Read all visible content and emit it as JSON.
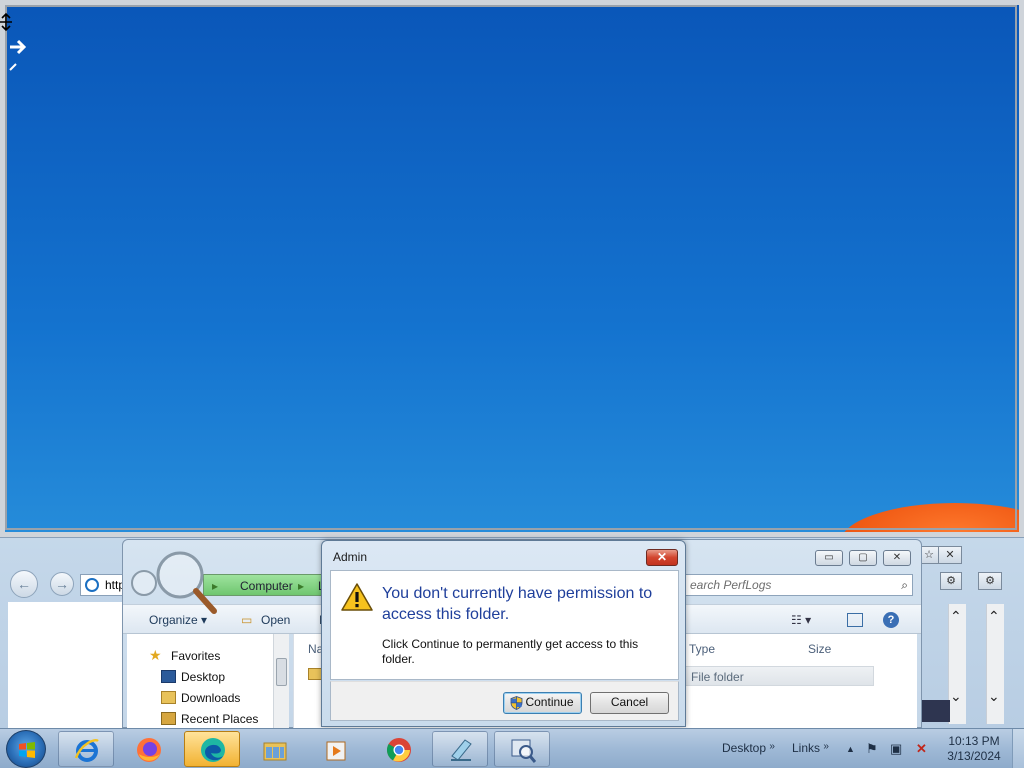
{
  "dialog": {
    "title": "Admin",
    "close_glyph": "✕",
    "heading": "You don't currently have permission to access this folder.",
    "message": "Click Continue to permanently get access to this folder.",
    "continue_label": "Continue",
    "cancel_label": "Cancel",
    "icon": "warning-icon"
  },
  "ie_window": {
    "address_text": "http",
    "back_glyph": "←",
    "forward_glyph": "→"
  },
  "explorer": {
    "breadcrumb": "Computer",
    "breadcrumb_next": "L",
    "search_placeholder": "earch PerfLogs",
    "toolbar": {
      "organize": "Organize",
      "open": "Open",
      "cut_item": "I"
    },
    "nav": {
      "favorites": "Favorites",
      "desktop": "Desktop",
      "downloads": "Downloads",
      "recent_places": "Recent Places"
    },
    "columns": {
      "name": "Na",
      "type": "Type",
      "size": "Size"
    },
    "row_type": "File folder",
    "caption": {
      "min": "▭",
      "max": "▢",
      "close": "✕"
    }
  },
  "taskbar": {
    "apps": [
      {
        "icon": "internet-explorer-icon"
      },
      {
        "icon": "firefox-icon"
      },
      {
        "icon": "edge-icon",
        "active": true
      },
      {
        "icon": "file-explorer-icon"
      },
      {
        "icon": "media-player-icon"
      },
      {
        "icon": "chrome-icon"
      },
      {
        "icon": "notepad-icon"
      },
      {
        "icon": "search-app-icon"
      }
    ],
    "toolbars": {
      "desktop": "Desktop",
      "links": "Links",
      "chevron": "»"
    },
    "clock": {
      "time": "10:13 PM",
      "date": "3/13/2024"
    },
    "tray": {
      "up_arrow": "▲",
      "flag": "⚑",
      "network": "▣",
      "volume": "✕"
    }
  },
  "colors": {
    "accent": "#1f3f9b",
    "close_red": "#c2331f",
    "desktop_blue": "#1473cf"
  }
}
